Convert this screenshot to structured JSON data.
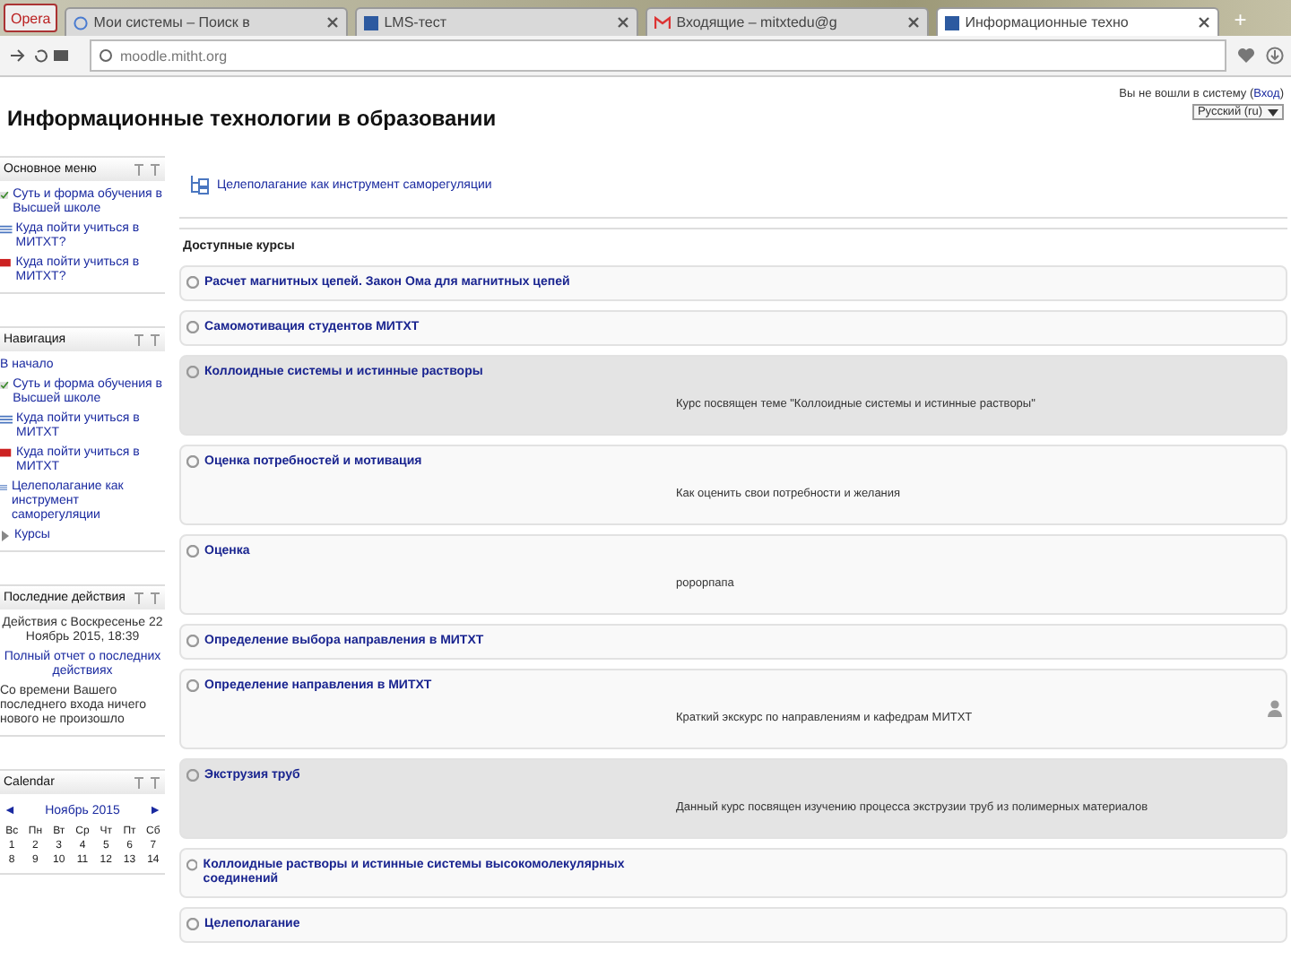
{
  "browser": {
    "menu_button": "Opera",
    "tabs": [
      {
        "title": "Мои системы – Поиск в",
        "selected": false,
        "kind": "search"
      },
      {
        "title": "LMS-тест",
        "selected": false,
        "kind": "site"
      },
      {
        "title": "Входящие – mitxtedu@g",
        "selected": false,
        "kind": "mail"
      },
      {
        "title": "Информационные техно",
        "selected": true,
        "kind": "site"
      }
    ],
    "new_tab": "+",
    "url": "moodle.mitht.org"
  },
  "header": {
    "title": "Информационные технологии в образовании",
    "login_text": "Вы не вошли в систему (",
    "login_link": "Вход",
    "login_close": ")",
    "language": "Русский (ru)"
  },
  "blocks": [
    {
      "kind": "menu",
      "title": "Основное меню",
      "items": [
        {
          "label": "Суть и форма обучения в Высшей школе",
          "kind": "check"
        },
        {
          "label": "Куда пойти учиться в МИТХТ?",
          "kind": "list"
        },
        {
          "label": "Куда пойти учиться в МИТХТ?",
          "kind": "flag"
        }
      ]
    },
    {
      "kind": "navigation",
      "title": "Навигация",
      "home": "В начало",
      "items": [
        {
          "label": "Суть и форма обучения в Высшей школе",
          "kind": "check"
        },
        {
          "label": "Куда пойти учиться в МИТХТ",
          "kind": "list"
        },
        {
          "label": "Куда пойти учиться в МИТХТ",
          "kind": "flag"
        },
        {
          "label": "Целеполагание как инструмент саморегуляции",
          "kind": "list"
        },
        {
          "label": "Курсы",
          "kind": "arrow"
        }
      ]
    },
    {
      "kind": "activity",
      "title": "Последние действия",
      "since": "Действия с Воскресенье 22 Ноябрь 2015, 18:39",
      "report_link": "Полный отчет о последних действиях",
      "note": "Со времени Вашего последнего входа ничего нового не произошло"
    },
    {
      "kind": "calendar",
      "title": "Calendar",
      "prev": "◄",
      "month": "Ноябрь 2015",
      "next": "►",
      "weekdays": [
        "Вс",
        "Пн",
        "Вт",
        "Ср",
        "Чт",
        "Пт",
        "Сб"
      ],
      "weeks": [
        [
          "1",
          "2",
          "3",
          "4",
          "5",
          "6",
          "7"
        ],
        [
          "8",
          "9",
          "10",
          "11",
          "12",
          "13",
          "14"
        ]
      ]
    }
  ],
  "main": {
    "top_link": "Целеполагание как инструмент саморегуляции",
    "courses_heading": "Доступные курсы",
    "courses": [
      {
        "name": "Расчет магнитных цепей. Закон Ома для магнитных цепей",
        "shaded": false,
        "teacher": false
      },
      {
        "name": "Самомотивация студентов МИТХТ",
        "shaded": false,
        "teacher": false
      },
      {
        "name": "Коллоидные системы и истинные растворы",
        "summary": "Курс посвящен теме \"Коллоидные системы и истинные растворы\"",
        "shaded": true,
        "teacher": false
      },
      {
        "name": "Оценка потребностей и мотивация",
        "summary": "Как оценить свои потребности и желания",
        "shaded": false,
        "teacher": false
      },
      {
        "name": "Оценка",
        "summary": "ророрпапа",
        "shaded": false,
        "teacher": false
      },
      {
        "name": "Определение выбора направления в МИТХТ",
        "shaded": false,
        "teacher": false
      },
      {
        "name": "Определение направления в МИТХТ",
        "summary": "Краткий экскурс по направлениям и кафедрам МИТХТ",
        "shaded": false,
        "teacher": true
      },
      {
        "name": "Экструзия труб",
        "summary": "Данный курс посвящен изучению процесса экструзии труб из полимерных материалов",
        "shaded": true,
        "teacher": false
      },
      {
        "name": "Коллоидные растворы и истинные системы высокомолекулярных соединений",
        "shaded": false,
        "teacher": false
      },
      {
        "name": "Целеполагание",
        "shaded": false,
        "teacher": false
      }
    ]
  }
}
